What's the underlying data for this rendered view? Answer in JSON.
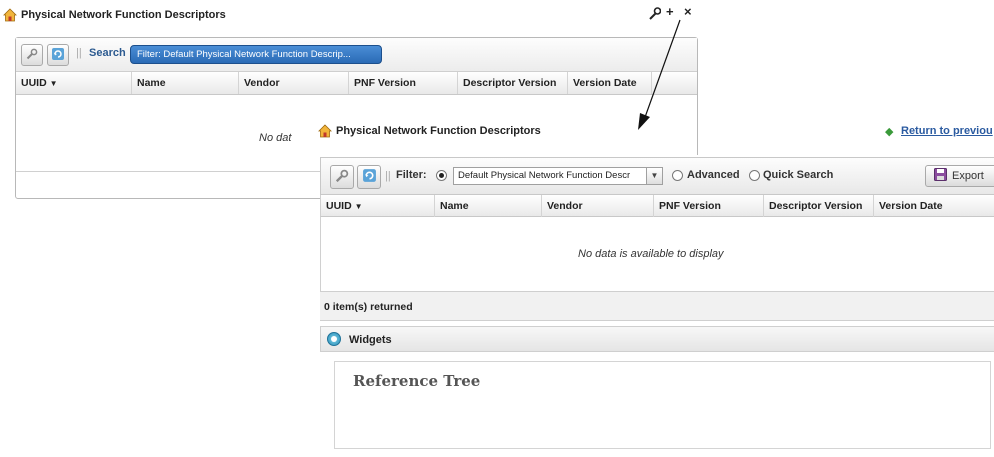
{
  "background_window": {
    "title": "Physical Network Function Descriptors",
    "controls": {
      "wrench": "⚒",
      "plus": "+",
      "close": "×"
    },
    "toolbar": {
      "search_label": "Search",
      "filter_chip": "Filter: Default Physical Network Function Descrip..."
    },
    "columns": [
      "UUID",
      "Name",
      "Vendor",
      "PNF Version",
      "Descriptor Version",
      "Version Date"
    ],
    "empty_text": "No dat"
  },
  "main_window": {
    "title": "Physical Network Function Descriptors",
    "return_link": "Return to previou",
    "toolbar": {
      "filter_label": "Filter:",
      "filter_select_value": "Default Physical Network Function Descr",
      "advanced_label": "Advanced",
      "quick_search_label": "Quick Search",
      "export_label": "Export"
    },
    "columns": [
      "UUID",
      "Name",
      "Vendor",
      "PNF Version",
      "Descriptor Version",
      "Version Date"
    ],
    "empty_text": "No data is available to display",
    "item_count": "0 item(s) returned",
    "widgets_label": "Widgets",
    "reference_tree_label": "Reference Tree"
  },
  "colors": {
    "link": "#2a5aa0",
    "filter_chip": "#2a6ab5",
    "search_label": "#2c5a90"
  }
}
